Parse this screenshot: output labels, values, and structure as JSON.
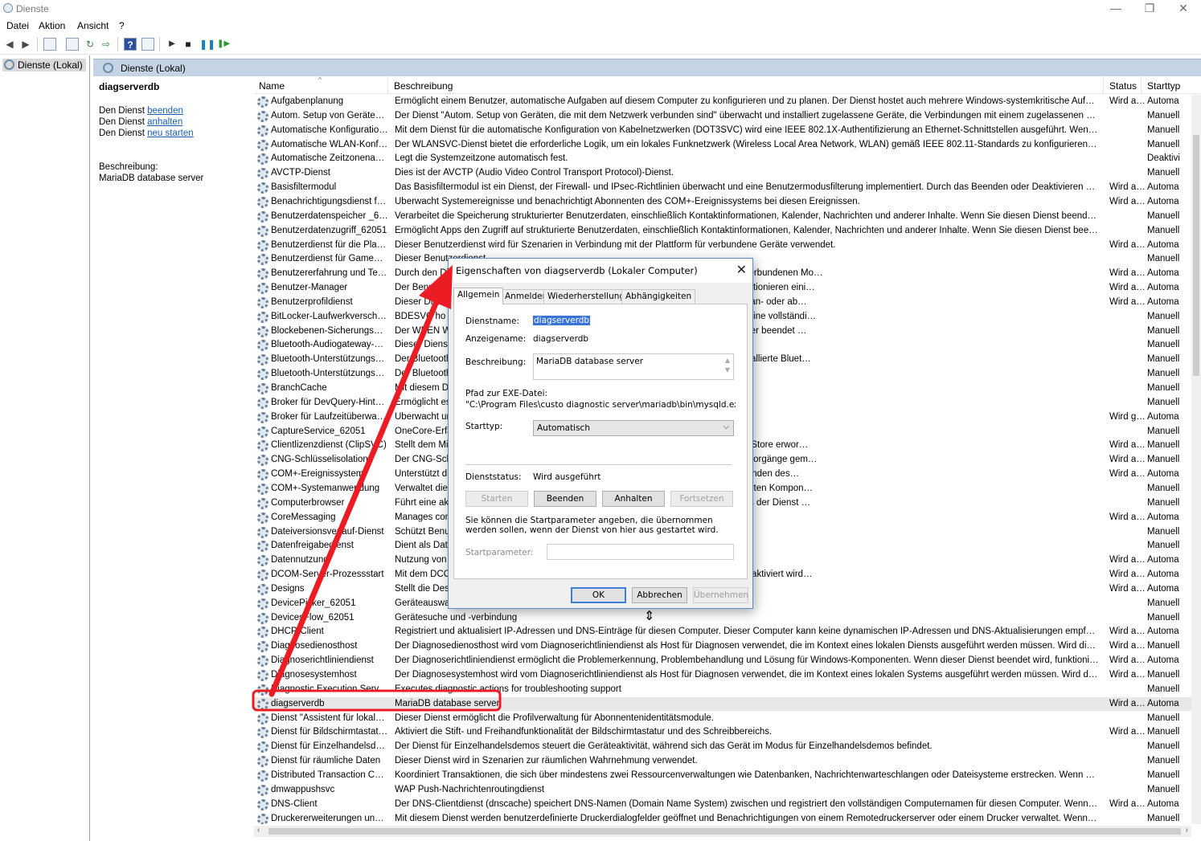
{
  "window": {
    "title": "Dienste",
    "controls": [
      "—",
      "❐",
      "✕"
    ]
  },
  "menu": [
    "Datei",
    "Aktion",
    "Ansicht",
    "?"
  ],
  "toolbar_icons": [
    "back-icon",
    "forward-icon",
    "console-tree-icon",
    "properties-icon",
    "refresh-icon",
    "export-icon",
    "help-icon",
    "view-icon",
    "play-icon",
    "stop-icon",
    "pause-icon",
    "restart-icon"
  ],
  "tree": {
    "root_label": "Dienste (Lokal)"
  },
  "main_header": {
    "title": "Dienste (Lokal)"
  },
  "extended_pane": {
    "service_name": "diagserverdb",
    "actions": [
      {
        "prefix": "Den Dienst ",
        "link": "beenden"
      },
      {
        "prefix": "Den Dienst ",
        "link": "anhalten"
      },
      {
        "prefix": "Den Dienst ",
        "link": "neu starten"
      }
    ],
    "description_label": "Beschreibung:",
    "description": "MariaDB database server"
  },
  "columns": {
    "name": "Name",
    "description": "Beschreibung",
    "status": "Status",
    "starttype": "Starttyp"
  },
  "rows": [
    {
      "n": "Aufgabenplanung",
      "d": "Ermöglicht einem Benutzer, automatische Aufgaben auf diesem Computer zu konfigurieren und zu planen. Der Dienst hostet auch mehrere Windows-systemkritische Aufgaben…",
      "s": "Wird au…",
      "t": "Automa"
    },
    {
      "n": "Autom. Setup von Geräten, …",
      "d": "Der Dienst \"Autom. Setup von Geräten, die mit dem Netzwerk verbunden sind\" überwacht und installiert zugelassene Geräte, die Verbindungen mit einem zugelassenen Netzwer…",
      "s": "",
      "t": "Manuell"
    },
    {
      "n": "Automatische Konfiguratio…",
      "d": "Mit dem Dienst für die automatische Konfiguration von Kabelnetzwerken (DOT3SVC) wird eine IEEE 802.1X-Authentifizierung an Ethernet-Schnittstellen ausgeführt. Wenn bei der…",
      "s": "",
      "t": "Manuell"
    },
    {
      "n": "Automatische WLAN-Konfi…",
      "d": "Der WLANSVC-Dienst bietet die erforderliche Logik, um ein lokales Funknetzwerk (Wireless Local Area Network, WLAN) gemäß IEEE 802.11-Standards zu konfigurieren, zu ermitt…",
      "s": "",
      "t": "Manuell"
    },
    {
      "n": "Automatische Zeitzonenakt…",
      "d": "Legt die Systemzeitzone automatisch fest.",
      "s": "",
      "t": "Deaktivi"
    },
    {
      "n": "AVCTP-Dienst",
      "d": "Dies ist der AVCTP (Audio Video Control Transport Protocol)-Dienst.",
      "s": "",
      "t": "Manuell"
    },
    {
      "n": "Basisfiltermodul",
      "d": "Das Basisfiltermodul ist ein Dienst, der Firewall- und IPsec-Richtlinien überwacht und eine Benutzermodusfilterung implementiert. Durch das Beenden oder Deaktivieren des BF…",
      "s": "Wird au…",
      "t": "Automa"
    },
    {
      "n": "Benachrichtigungsdienst fü…",
      "d": "Überwacht Systemereignisse und benachrichtigt Abonnenten des COM+-Ereignissystems bei diesen Ereignissen.",
      "s": "Wird au…",
      "t": "Automa"
    },
    {
      "n": "Benutzerdatenspeicher _620…",
      "d": "Verarbeitet die Speicherung strukturierter Benutzerdaten, einschließlich Kontaktinformationen, Kalender, Nachrichten und anderer Inhalte. Wenn Sie diesen Dienst beenden oder …",
      "s": "",
      "t": "Manuell"
    },
    {
      "n": "Benutzerdatenzugriff_62051",
      "d": "Ermöglicht Apps den Zugriff auf strukturierte Benutzerdaten, einschließlich Kontaktinformationen, Kalender, Nachrichten und anderer Inhalte. Wenn Sie diesen Dienst beenden …",
      "s": "",
      "t": "Manuell"
    },
    {
      "n": "Benutzerdienst für die Plattf…",
      "d": "Dieser Benutzerdienst wird für Szenarien in Verbindung mit der Plattform für verbundene Geräte verwendet.",
      "s": "Wird au…",
      "t": "Automa"
    },
    {
      "n": "Benutzerdienst für GameDV…",
      "d": "Dieser Benutzerdienst",
      "s": "",
      "t": "Manuell"
    },
    {
      "n": "Benutzererfahrung und Tele…",
      "d": "Durch den Dienst                                                                                    atures aktiviert, die Benutzerfreundlichkeit in Anwendungen und im verbundenen Mo…",
      "s": "Wird au…",
      "t": "Automa"
    },
    {
      "n": "Benutzer-Manager",
      "d": "Der Benutzer-                                                                                        reren Benutzern erforderlich sind. Wenn dieser Dienst beendet wird, funktionieren eini…",
      "s": "Wird au…",
      "t": "Automa"
    },
    {
      "n": "Benutzerprofildienst",
      "d": "Dieser Dienst                                                                                          ser Dienst beendet oder deaktiviert ist, können Benutzer sich nicht mehr an- oder ab…",
      "s": "Wird au…",
      "t": "Automa"
    },
    {
      "n": "BitLocker-Laufwerkverschlü…",
      "d": "BDESVC ho                                                                                              schlüsselung ermöglicht einen sicheren Start des Betriebssystems sowie eine vollständi…",
      "s": "",
      "t": "Manuell"
    },
    {
      "n": "Blockebenen-Sicherungsm…",
      "d": "Der WBEN                                                                                              Wiederherstellungsvorgänge auszuführen. Wenn dieser Dienst vom Benutzer beendet …",
      "s": "",
      "t": "Manuell"
    },
    {
      "n": "Bluetooth-Audiogateway-D…",
      "d": "Dieser Dienst",
      "s": "",
      "t": "Manuell"
    },
    {
      "n": "Bluetooth-Unterstützungsdi…",
      "d": "Der Bluetooth                                                                                         räten. Wird der Dienst beendet oder deaktiviert, funktionieren bereits installierte Bluet…",
      "s": "",
      "t": "Manuell"
    },
    {
      "n": "Bluetooth-Unterstützungsdi…",
      "d": "Der Bluetooth                                                                                         gemäße Funktionsweise der relevanten Bluetooth-Features.",
      "s": "",
      "t": "Manuell"
    },
    {
      "n": "BranchCache",
      "d": "Mit diesem Di                                                                                         ert.",
      "s": "",
      "t": "Manuell"
    },
    {
      "n": "Broker für DevQuery-Hinter…",
      "d": "Ermöglicht es",
      "s": "",
      "t": "Manuell"
    },
    {
      "n": "Broker für Laufzeitüberwac…",
      "d": "Überwacht un",
      "s": "Wird ge…",
      "t": "Automa"
    },
    {
      "n": "CaptureService_62051",
      "d": "OneCore-Erfa",
      "s": "",
      "t": "Manuell"
    },
    {
      "n": "Clientlizenzdienst (ClipSVC)",
      "d": "Stellt dem Mi                                                                                          artet. Wenn der Dienst deaktiviert wird, verhalten sich über den Windows Store erwor…",
      "s": "Wird au…",
      "t": "Manuell"
    },
    {
      "n": "CNG-Schlüsselisolation",
      "d": "Der CNG-Schl                                                                                          üsselprozessisolation für private Schlüssel und zugehörige Kryptografievorgänge gem…",
      "s": "Wird au…",
      "t": "Manuell"
    },
    {
      "n": "COM+-Ereignissystem",
      "d": "Unterstützt d                                                                                          natisch an abonnierte COM-Komponenten verteilt werden. Nach dem Beenden des…",
      "s": "Wird au…",
      "t": "Automa"
    },
    {
      "n": "COM+-Systemanwendung",
      "d": "Verwaltet die                                                                                          onenten. Nach dem Beenden des Dienstes sind die meisten COM+-basierten Kompon…",
      "s": "",
      "t": "Manuell"
    },
    {
      "n": "Computerbrowser",
      "d": "Führt eine akt                                                                                         de Computer weiter. Diese Liste wird nicht aktualisiert oder gewartet, falls der Dienst …",
      "s": "",
      "t": "Manuell"
    },
    {
      "n": "CoreMessaging",
      "d": "Manages com",
      "s": "Wird au…",
      "t": "Automa"
    },
    {
      "n": "Dateiversionsverlauf-Dienst",
      "d": "Schützt Benut                                                                                         inen Sicherungsspeicherort.",
      "s": "",
      "t": "Manuell"
    },
    {
      "n": "Datenfreigabedienst",
      "d": "Dient als Date",
      "s": "",
      "t": "Manuell"
    },
    {
      "n": "Datennutzung",
      "d": "Nutzung von                                                                                            Netzwerke.",
      "s": "Wird au…",
      "t": "Automa"
    },
    {
      "n": "DCOM-Server-Prozessstart",
      "d": "Mit dem DCO                                                                                         ktivierungsanforderungen gestartet. Wenn dieser Dienst beendet oder deaktiviert wird…",
      "s": "Wird au…",
      "t": "Automa"
    },
    {
      "n": "Designs",
      "d": "Stellt die Desi",
      "s": "Wird au…",
      "t": "Automa"
    },
    {
      "n": "DevicePicker_62051",
      "d": "Geräteauswa",
      "s": "",
      "t": "Manuell"
    },
    {
      "n": "DevicesFlow_62051",
      "d": "Gerätesuche und -verbindung",
      "s": "",
      "t": "Manuell"
    },
    {
      "n": "DHCP-Client",
      "d": "Registriert und aktualisiert IP-Adressen und DNS-Einträge für diesen Computer. Dieser Computer kann keine dynamischen IP-Adressen und DNS-Aktualisierungen empfangen, f…",
      "s": "Wird au…",
      "t": "Automa"
    },
    {
      "n": "Diagnosedienosthost",
      "d": "Der Diagnosedienosthost wird vom Diagnoserichtliniendienst als Host für Diagnosen verwendet, die im Kontext eines lokalen Diensts ausgeführt werden müssen. Wird dieser Dien…",
      "s": "Wird au…",
      "t": "Manuell"
    },
    {
      "n": "Diagnoserichtliniendienst",
      "d": "Der Diagnoserichtliniendienst ermöglicht die Problemerkennung, Problembehandlung und Lösung für Windows-Komponenten. Wenn dieser Dienst beendet wird, funktioniert …",
      "s": "Wird au…",
      "t": "Automa"
    },
    {
      "n": "Diagnosesystemhost",
      "d": "Der Diagnosesystemhost wird vom Diagnoserichtliniendienst als Host für Diagnosen verwendet, die im Kontext eines lokalen Systems ausgeführt werden müssen. Wird dieser Die…",
      "s": "Wird au…",
      "t": "Manuell"
    },
    {
      "n": "Diagnostic Execution Service",
      "d": "Executes diagnostic actions for troubleshooting support",
      "s": "",
      "t": "Manuell"
    },
    {
      "n": "diagserverdb",
      "d": "MariaDB database server",
      "s": "Wird au…",
      "t": "Automa",
      "selected": true
    },
    {
      "n": "Dienst \"Assistent für lokale …",
      "d": "Dieser Dienst ermöglicht die Profilverwaltung für Abonnentenidentitätsmodule.",
      "s": "",
      "t": "Manuell"
    },
    {
      "n": "Dienst für Bildschirmtastatu…",
      "d": "Aktiviert die Stift- und Freihandfunktionalität der Bildschirmtastatur und des Schreibbereichs.",
      "s": "Wird au…",
      "t": "Manuell"
    },
    {
      "n": "Dienst für Einzelhandelsde…",
      "d": "Der Dienst für Einzelhandelsdemos steuert die Geräteaktivität, während sich das Gerät im Modus für Einzelhandelsdemos befindet.",
      "s": "",
      "t": "Manuell"
    },
    {
      "n": "Dienst für räumliche Daten",
      "d": "Dieser Dienst wird in Szenarien zur räumlichen Wahrnehmung verwendet.",
      "s": "",
      "t": "Manuell"
    },
    {
      "n": "Distributed Transaction Coo…",
      "d": "Koordiniert Transaktionen, die sich über mindestens zwei Ressourcenverwaltungen wie Datenbanken, Nachrichtenwarteschlangen oder Dateisysteme erstrecken. Wenn der Diens…",
      "s": "",
      "t": "Manuell"
    },
    {
      "n": "dmwappushsvc",
      "d": "WAP Push-Nachrichtenroutingdienst",
      "s": "",
      "t": "Manuell"
    },
    {
      "n": "DNS-Client",
      "d": "Der DNS-Clientdienst (dnscache) speichert DNS-Namen (Domain Name System) zwischen und registriert den vollständigen Computernamen für diesen Computer. Wenn der Di…",
      "s": "Wird au…",
      "t": "Automa"
    },
    {
      "n": "Druckererweiterungen und …",
      "d": "Mit diesem Dienst werden benutzerdefinierte Druckerdialogfelder geöffnet und Benachrichtigungen von einem Remotedruckerserver oder einem Drucker verwaltet. Wenn Sie di…",
      "s": "",
      "t": "Manuell"
    }
  ],
  "dialog": {
    "title": "Eigenschaften von diagserverdb (Lokaler Computer)",
    "close": "✕",
    "tabs": [
      "Allgemein",
      "Anmelden",
      "Wiederherstellung",
      "Abhängigkeiten"
    ],
    "labels": {
      "service_name": "Dienstname:",
      "display_name": "Anzeigename:",
      "description": "Beschreibung:",
      "exe_path": "Pfad zur EXE-Datei:",
      "starttype": "Starttyp:",
      "status": "Dienststatus:",
      "hint": "Sie können die Startparameter angeben, die übernommen werden sollen, wenn der Dienst von hier aus gestartet wird.",
      "startparam": "Startparameter:"
    },
    "values": {
      "service_name": "diagserverdb",
      "display_name": "diagserverdb",
      "description": "MariaDB database server",
      "exe_path": "\"C:\\Program Files\\custo diagnostic server\\mariadb\\bin\\mysqld.exe\" \"--defau",
      "starttype": "Automatisch",
      "status": "Wird ausgeführt",
      "startparam": ""
    },
    "buttons": {
      "start": "Starten",
      "stop": "Beenden",
      "pause": "Anhalten",
      "resume": "Fortsetzen",
      "ok": "OK",
      "cancel": "Abbrechen",
      "apply": "Übernehmen"
    }
  },
  "colors": {
    "annotation": "#ec1c24",
    "accent": "#3874d8",
    "header_bg": "#c5d4e4"
  }
}
